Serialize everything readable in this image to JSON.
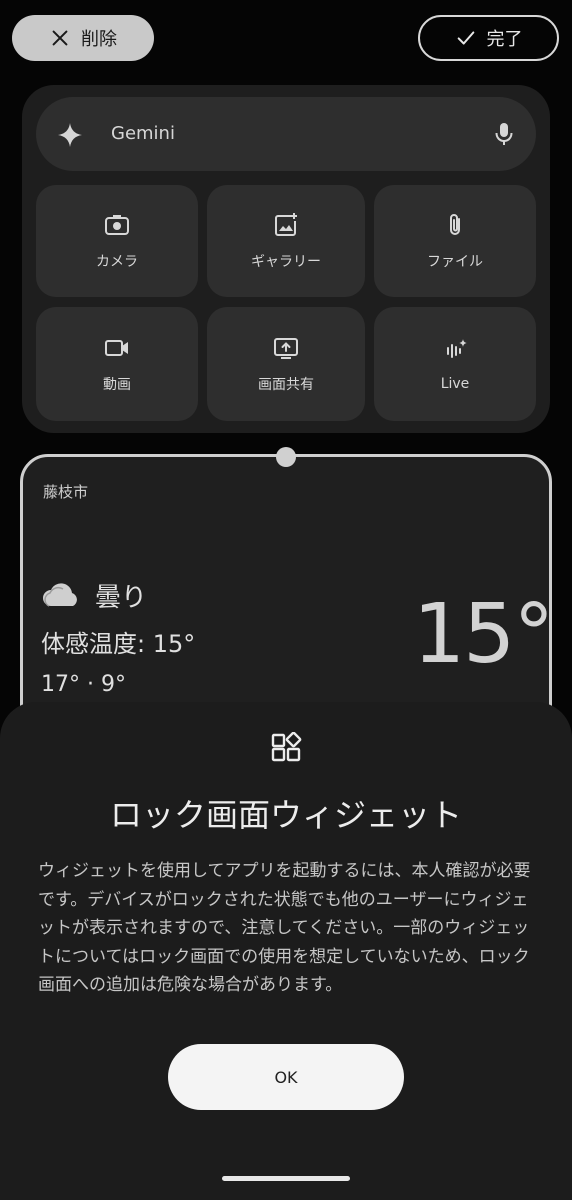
{
  "top_bar": {
    "delete_label": "削除",
    "done_label": "完了"
  },
  "gemini": {
    "title": "Gemini",
    "tiles": [
      {
        "label": "カメラ",
        "icon": "camera-icon"
      },
      {
        "label": "ギャラリー",
        "icon": "gallery-icon"
      },
      {
        "label": "ファイル",
        "icon": "paperclip-icon"
      },
      {
        "label": "動画",
        "icon": "video-icon"
      },
      {
        "label": "画面共有",
        "icon": "screen-share-icon"
      },
      {
        "label": "Live",
        "icon": "live-icon"
      }
    ]
  },
  "weather": {
    "city": "藤枝市",
    "condition": "曇り",
    "feels_like": "体感温度: 15°",
    "high_low": "17° · 9°",
    "temperature": "15°"
  },
  "sheet": {
    "title": "ロック画面ウィジェット",
    "body": "ウィジェットを使用してアプリを起動するには、本人確認が必要です。デバイスがロックされた状態でも他のユーザーにウィジェットが表示されますので、注意してください。一部のウィジェットについてはロック画面での使用を想定していないため、ロック画面への追加は危険な場合があります。",
    "ok_label": "OK"
  }
}
